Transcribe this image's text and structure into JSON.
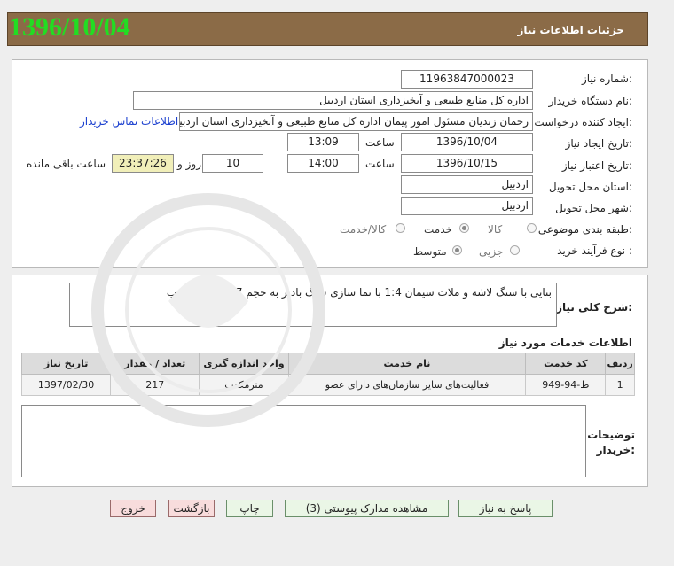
{
  "header": {
    "title": "جزئیات اطلاعات نیاز",
    "big_date": "1396/10/04"
  },
  "form": {
    "need_number_label": "شماره نیاز:",
    "need_number": "11963847000023",
    "buyer_label": "نام دستگاه خریدار:",
    "buyer": "اداره کل منابع طبیعی و آبخیزداری استان اردبیل",
    "creator_label": "ایجاد کننده درخواست:",
    "creator": "رحمان زندیان مسئول امور پیمان اداره کل منابع طبیعی و آبخیزداری استان اردبیل",
    "contact_link": "اطلاعات تماس خریدار",
    "created_label": "تاریخ ایجاد نیاز:",
    "created_date": "1396/10/04",
    "time_label": "ساعت",
    "created_time": "13:09",
    "validity_label": "تاریخ اعتبار نیاز:",
    "validity_date": "1396/10/15",
    "validity_time": "14:00",
    "days_value": "10",
    "days_label": "روز و",
    "remaining_time": "23:37:26",
    "remaining_label": "ساعت باقی مانده",
    "province_label": "استان محل تحویل:",
    "province": "اردبیل",
    "city_label": "شهر محل تحویل:",
    "city": "اردبیل",
    "category_label": "طبقه بندی موضوعی:",
    "category_options": [
      "کالا",
      "خدمت",
      "کالا/خدمت"
    ],
    "category_selected": "خدمت",
    "process_label": "نوع فرآیند خرید :",
    "process_options": [
      "جزیی",
      "متوسط"
    ],
    "process_selected": "متوسط"
  },
  "description": {
    "label": "شرح کلی نیاز:",
    "text": "بنایی با سنگ لاشه و ملات سیمان 1:4 با نما سازی سنگ بادبر به حجم 217/7متر مکعب"
  },
  "services": {
    "title": "اطلاعات خدمات مورد نیاز",
    "columns": [
      "ردیف",
      "کد خدمت",
      "نام خدمت",
      "واحد اندازه گیری",
      "تعداد / مقدار",
      "تاریخ نیاز"
    ],
    "rows": [
      [
        "1",
        "ط-94-949",
        "فعالیت‌های سایر سازمان‌های دارای عضو",
        "مترمکعب",
        "217",
        "1397/02/30"
      ]
    ]
  },
  "buyer_notes": {
    "label_line1": "توضیحات",
    "label_line2": "خریدار:"
  },
  "buttons": {
    "reply": "پاسخ به نیاز",
    "attachments": "مشاهده مدارک پیوستی (3)",
    "print": "چاپ",
    "back": "بازگشت",
    "exit": "خروج"
  },
  "colors": {
    "title_bar": "#8b6b47",
    "big_date": "#22dd22",
    "link": "#1a3fcf"
  }
}
